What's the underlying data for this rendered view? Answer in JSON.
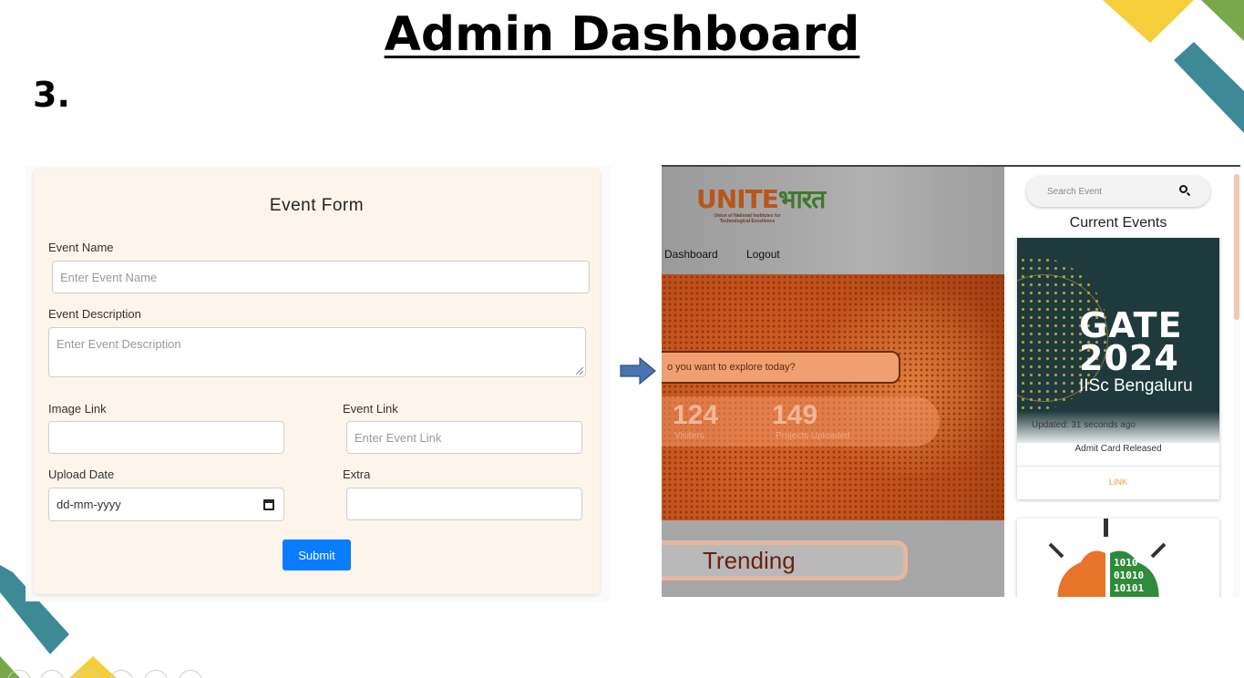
{
  "slide": {
    "title": "Admin Dashboard",
    "number": "3."
  },
  "colors": {
    "accent_blue": "#0a7cff",
    "teal": "#3d8a96",
    "yellow": "#f4cf3a",
    "green": "#78a849",
    "form_bg": "#fdf4ec"
  },
  "event_form": {
    "title": "Event Form",
    "event_name_label": "Event Name",
    "event_name_placeholder": "Enter Event Name",
    "event_description_label": "Event Description",
    "event_description_placeholder": "Enter Event Description",
    "image_link_label": "Image Link",
    "image_link_value": "",
    "event_link_label": "Event Link",
    "event_link_placeholder": "Enter Event Link",
    "upload_date_label": "Upload Date",
    "upload_date_placeholder": "dd-mm-yyyy",
    "extra_label": "Extra",
    "extra_value": "",
    "submit_label": "Submit"
  },
  "arrow_icon": "right-arrow-icon",
  "site": {
    "logo_part1": "UNITE",
    "logo_part2": "भारत",
    "logo_subtitle": "Union of National Institutes for Technological Excellence",
    "nav": [
      "Dashboard",
      "Logout"
    ],
    "search_placeholder": "o you want to explore today?",
    "stats": [
      {
        "value": "124",
        "label": "Visiters"
      },
      {
        "value": "149",
        "label": "Projects Uploaded"
      }
    ],
    "trending_label": "Trending",
    "sidebar": {
      "search_placeholder": "Search Event",
      "title": "Current Events",
      "event": {
        "image_line1": "GATE",
        "image_line2": "2024",
        "image_line3": "IISc Bengaluru",
        "updated": "Updated: 31 seconds ago",
        "subtitle": "Admit Card Released",
        "link": "LINK"
      }
    }
  }
}
